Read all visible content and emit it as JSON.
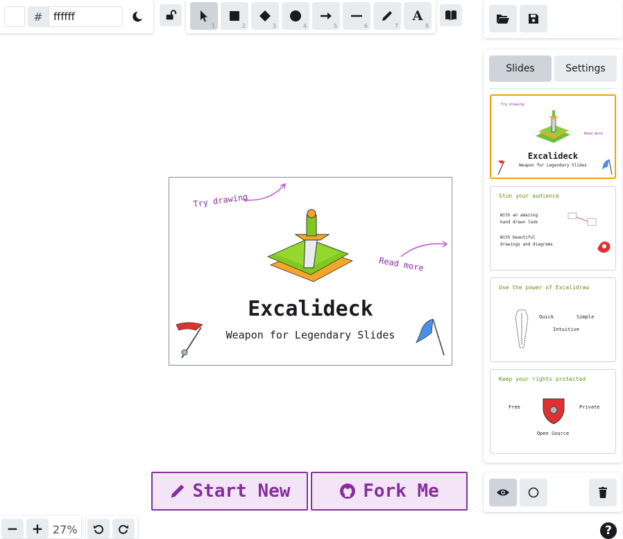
{
  "color_picker": {
    "hash": "#",
    "value": "ffffff"
  },
  "tools": [
    {
      "name": "selection",
      "key": "1"
    },
    {
      "name": "rectangle",
      "key": "2"
    },
    {
      "name": "diamond",
      "key": "3"
    },
    {
      "name": "ellipse",
      "key": "4"
    },
    {
      "name": "arrow",
      "key": "5"
    },
    {
      "name": "line",
      "key": "6"
    },
    {
      "name": "draw",
      "key": "7"
    },
    {
      "name": "text",
      "key": "8"
    }
  ],
  "text_tool_glyph": "A",
  "sidebar": {
    "tabs": [
      {
        "label": "Slides",
        "active": true
      },
      {
        "label": "Settings",
        "active": false
      }
    ]
  },
  "canvas_slide": {
    "try_drawing": "Try drawing",
    "read_more": "Read more",
    "title": "Excalideck",
    "subtitle": "Weapon for Legendary Slides"
  },
  "slides": [
    {
      "title": "Excalideck",
      "subtitle": "Weapon for Legendary Slides",
      "try": "Try drawing",
      "read": "Read more"
    },
    {
      "heading": "Stun your audience",
      "line1": "With an amazing",
      "line2": "hand drawn look",
      "line3": "With beautiful",
      "line4": "drawings and diagrams"
    },
    {
      "heading": "Use the power of Excalidraw",
      "w1": "Quick",
      "w2": "Simple",
      "w3": "Intuitive"
    },
    {
      "heading": "Keep your rights protected",
      "w1": "Free",
      "w2": "Private",
      "w3": "Open Source"
    }
  ],
  "buttons": {
    "start_new": "Start New",
    "fork_me": "Fork Me"
  },
  "zoom": {
    "minus": "−",
    "plus": "+",
    "level": "27%"
  },
  "help": "?",
  "colors": {
    "accent": "#862e9c",
    "selected_border": "#f59f00",
    "button_bg": "#e9ecef",
    "active_bg": "#ced4da"
  }
}
